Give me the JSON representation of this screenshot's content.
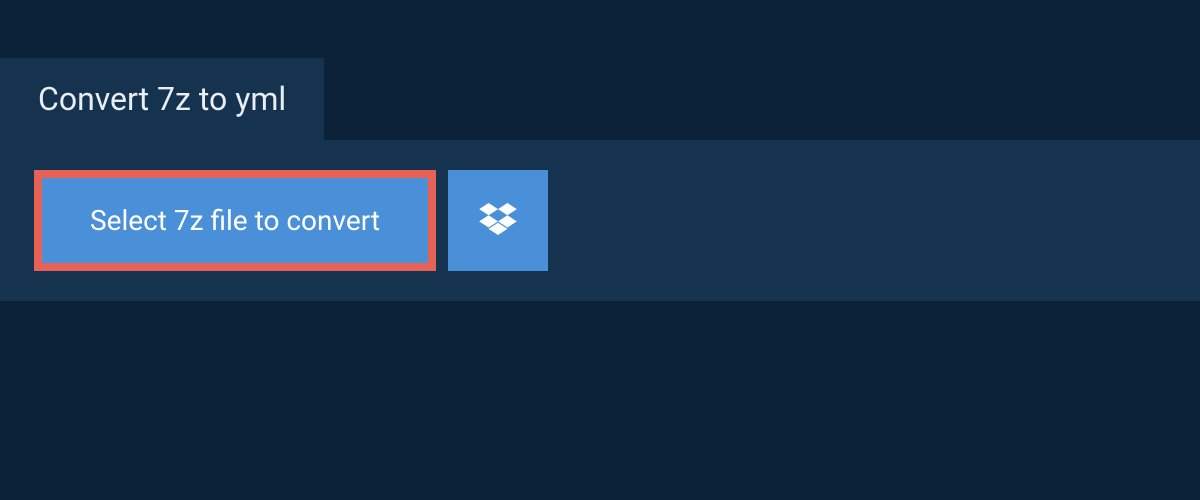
{
  "header": {
    "title": "Convert 7z to yml"
  },
  "actions": {
    "select_file_label": "Select 7z file to convert"
  },
  "colors": {
    "background": "#0b2239",
    "panel": "#15334f",
    "button": "#4a90d9",
    "highlight_border": "#e76256",
    "text_light": "#e8eef3",
    "text_white": "#ffffff"
  }
}
